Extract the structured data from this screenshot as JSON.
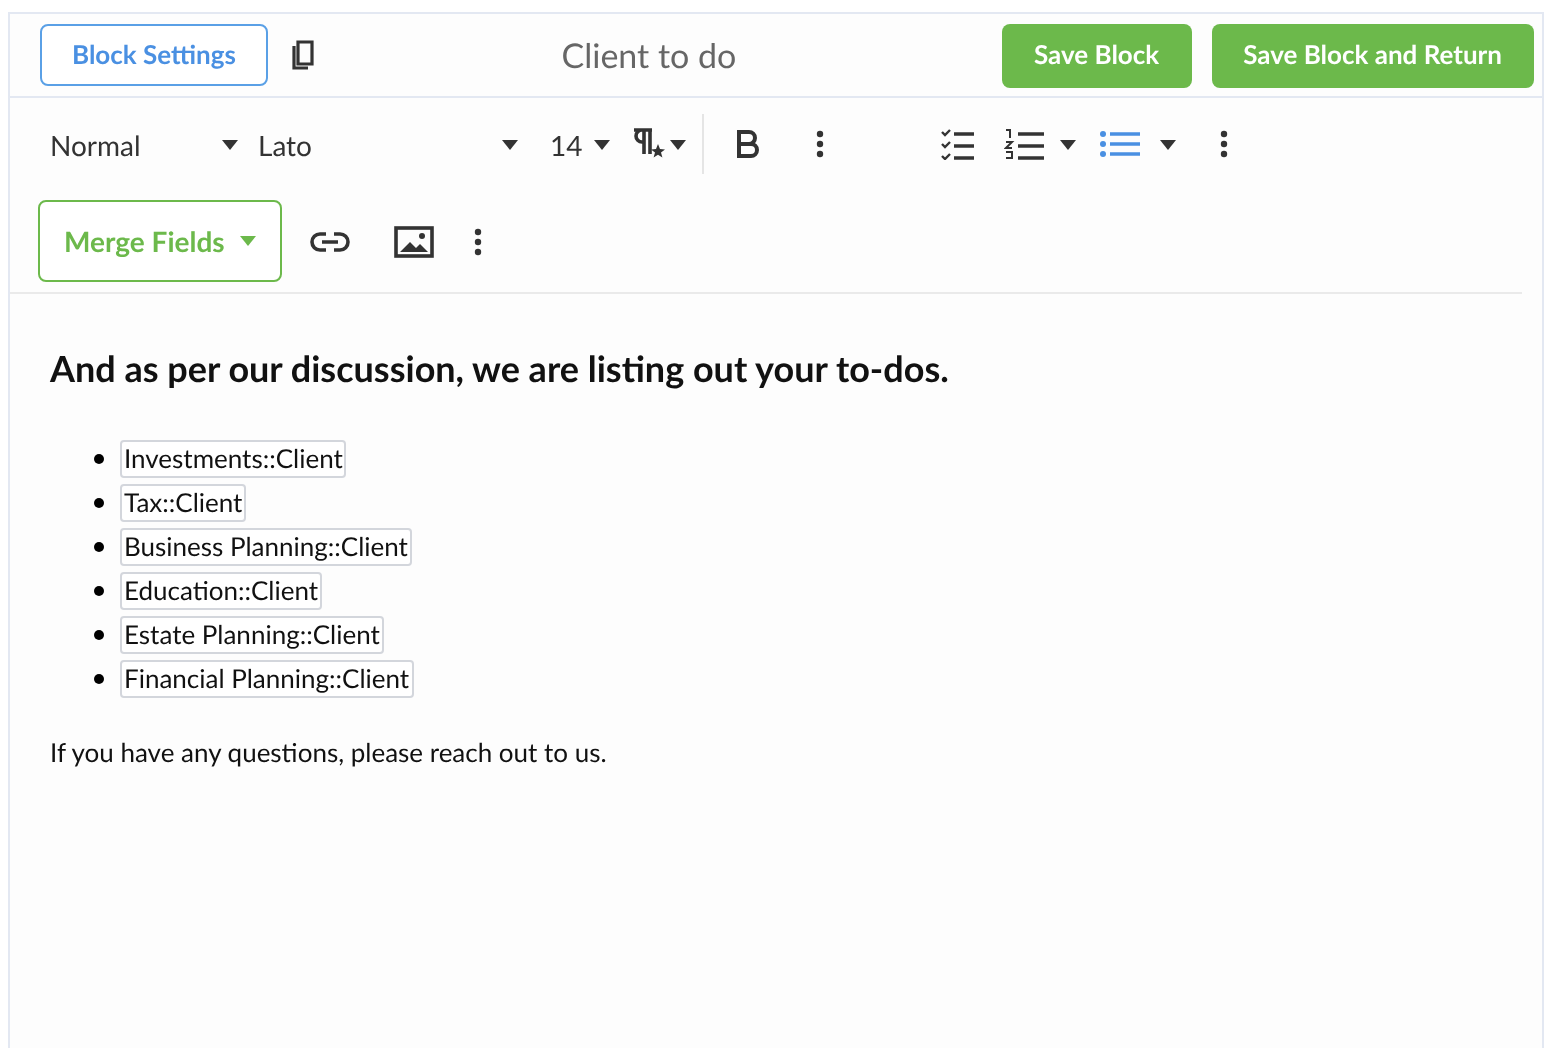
{
  "header": {
    "settings_button": "Block Settings",
    "title": "Client to do",
    "buttons": [
      "Save Block",
      "Save Block and Return"
    ]
  },
  "toolbar": {
    "style": "Normal",
    "font": "Lato",
    "size": "14",
    "numbered_list": {
      "selected": false
    },
    "bulleted_list": {
      "selected": true
    },
    "merge_button": "Merge Fields"
  },
  "content": {
    "heading": "And as per our discussion, we are listing out your to-dos.",
    "items": [
      "Investments::Client",
      "Tax::Client",
      "Business Planning::Client",
      "Education::Client",
      "Estate Planning::Client",
      "Financial Planning::Client"
    ],
    "footer": "If you have any questions, please reach out to us."
  }
}
